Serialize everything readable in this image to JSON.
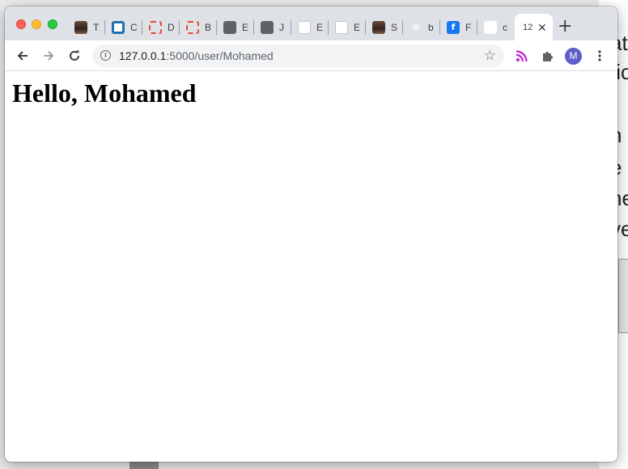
{
  "browser": {
    "tabs": [
      {
        "title": "T",
        "icon": "portrait-favicon-icon"
      },
      {
        "title": "C",
        "icon": "blue-circle-p-favicon-icon"
      },
      {
        "title": "D",
        "icon": "red-ring-favicon-icon"
      },
      {
        "title": "B",
        "icon": "red-ring-favicon-icon"
      },
      {
        "title": "E",
        "icon": "globe-favicon-icon"
      },
      {
        "title": "J",
        "icon": "globe-favicon-icon"
      },
      {
        "title": "E",
        "icon": "wikipedia-favicon-icon"
      },
      {
        "title": "E",
        "icon": "wikipedia-favicon-icon"
      },
      {
        "title": "S",
        "icon": "portrait-favicon-icon"
      },
      {
        "title": "b",
        "icon": "stackoverflow-favicon-icon"
      },
      {
        "title": "F",
        "icon": "facebook-favicon-icon"
      },
      {
        "title": "c",
        "icon": "google-favicon-icon"
      }
    ],
    "active_tab": {
      "title": "12"
    },
    "new_tab_label": "+",
    "address_bar": {
      "host": "127.0.0.1",
      "path": ":5000/user/Mohamed"
    },
    "profile_initial": "M"
  },
  "page": {
    "heading": "Hello, Mohamed"
  },
  "background_window": {
    "lines": [
      "at",
      "tic",
      "h",
      "e",
      "he",
      "ve"
    ]
  }
}
